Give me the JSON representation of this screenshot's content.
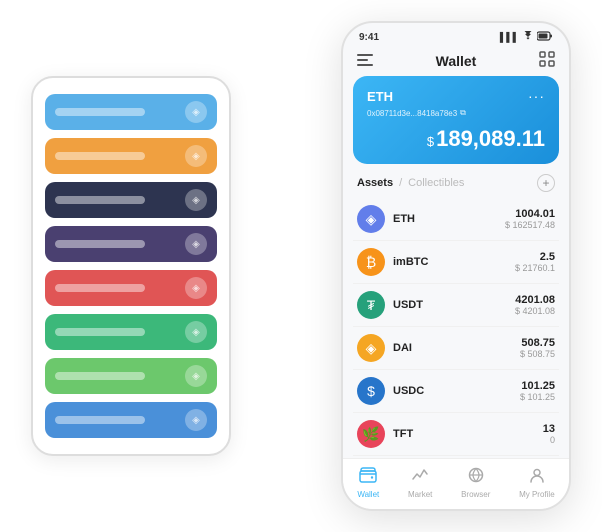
{
  "scene": {
    "card_stack": {
      "cards": [
        {
          "color": "#5ab0e8",
          "label_width": "90px"
        },
        {
          "color": "#f0a040",
          "label_width": "80px"
        },
        {
          "color": "#2d3450",
          "label_width": "85px"
        },
        {
          "color": "#4a4070",
          "label_width": "75px"
        },
        {
          "color": "#e05555",
          "label_width": "88px"
        },
        {
          "color": "#3cb87a",
          "label_width": "70px"
        },
        {
          "color": "#6cc86c",
          "label_width": "82px"
        },
        {
          "color": "#4a90d9",
          "label_width": "78px"
        }
      ]
    },
    "phone": {
      "status_bar": {
        "time": "9:41",
        "signal": "▌▌▌",
        "wifi": "WiFi",
        "battery": "🔋"
      },
      "nav": {
        "menu_icon": "☰",
        "title": "Wallet",
        "expand_icon": "⛶"
      },
      "eth_card": {
        "name": "ETH",
        "address": "0x08711d3e...8418a78e3",
        "copy_icon": "⧉",
        "dots": "···",
        "currency_symbol": "$",
        "balance": "189,089.11"
      },
      "assets_section": {
        "tab_active": "Assets",
        "separator": "/",
        "tab_inactive": "Collectibles",
        "add_icon": "+"
      },
      "assets": [
        {
          "symbol": "ETH",
          "icon_text": "◈",
          "icon_class": "icon-eth",
          "amount": "1004.01",
          "usd": "$ 162517.48"
        },
        {
          "symbol": "imBTC",
          "icon_text": "₿",
          "icon_class": "icon-imbtc",
          "amount": "2.5",
          "usd": "$ 21760.1"
        },
        {
          "symbol": "USDT",
          "icon_text": "₮",
          "icon_class": "icon-usdt",
          "amount": "4201.08",
          "usd": "$ 4201.08"
        },
        {
          "symbol": "DAI",
          "icon_text": "◈",
          "icon_class": "icon-dai",
          "amount": "508.75",
          "usd": "$ 508.75"
        },
        {
          "symbol": "USDC",
          "icon_text": "$",
          "icon_class": "icon-usdc",
          "amount": "101.25",
          "usd": "$ 101.25"
        },
        {
          "symbol": "TFT",
          "icon_text": "🌿",
          "icon_class": "icon-tft",
          "amount": "13",
          "usd": "0"
        }
      ],
      "bottom_nav": [
        {
          "icon": "👛",
          "label": "Wallet",
          "active": true
        },
        {
          "icon": "📊",
          "label": "Market",
          "active": false
        },
        {
          "icon": "🌐",
          "label": "Browser",
          "active": false
        },
        {
          "icon": "👤",
          "label": "My Profile",
          "active": false
        }
      ]
    }
  }
}
